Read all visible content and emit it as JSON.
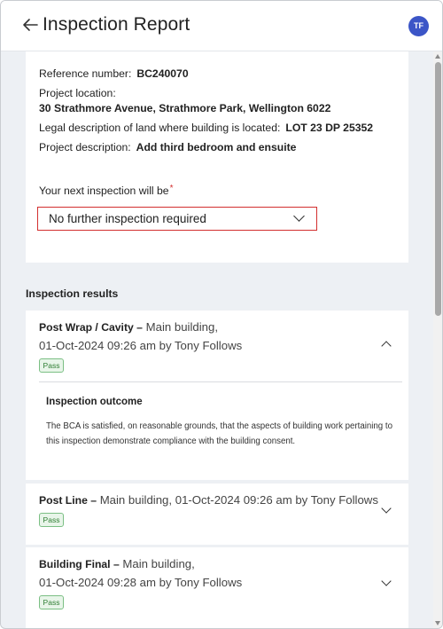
{
  "header": {
    "title": "Inspection Report",
    "avatar_initials": "TF"
  },
  "details": {
    "reference_label": "Reference number:",
    "reference_value": "BC240070",
    "location_label": "Project location:",
    "location_value": "30 Strathmore Avenue, Strathmore Park, Wellington 6022",
    "legal_label": "Legal description of land where building is located:",
    "legal_value": "LOT 23 DP 25352",
    "description_label": "Project description:",
    "description_value": "Add third bedroom and ensuite"
  },
  "next_inspection": {
    "label": "Your next inspection will be",
    "required_marker": "*",
    "selected": "No further inspection required"
  },
  "results": {
    "section_title": "Inspection results",
    "items": [
      {
        "type": "Post Wrap / Cavity –",
        "detail_1": "Main building,",
        "detail_2": "01-Oct-2024 09:26 am by Tony Follows",
        "status": "Pass",
        "expanded": true,
        "outcome_title": "Inspection outcome",
        "outcome_text": "The BCA is satisfied, on reasonable grounds, that the aspects of building work pertaining to this inspection demonstrate compliance with the building consent."
      },
      {
        "type": "Post Line –",
        "detail_1": "Main building,",
        "detail_2": "01-Oct-2024 09:26 am by Tony Follows",
        "status": "Pass",
        "expanded": false
      },
      {
        "type": "Building Final –",
        "detail_1": "Main building,",
        "detail_2": "01-Oct-2024 09:28 am by Tony Follows",
        "status": "Pass",
        "expanded": false
      }
    ]
  },
  "colors": {
    "accent": "#3b55c7",
    "error": "#d32f2f",
    "pass_bg": "#e8f5e9",
    "pass_text": "#2e7d32",
    "page_bg": "#edf0f4"
  }
}
